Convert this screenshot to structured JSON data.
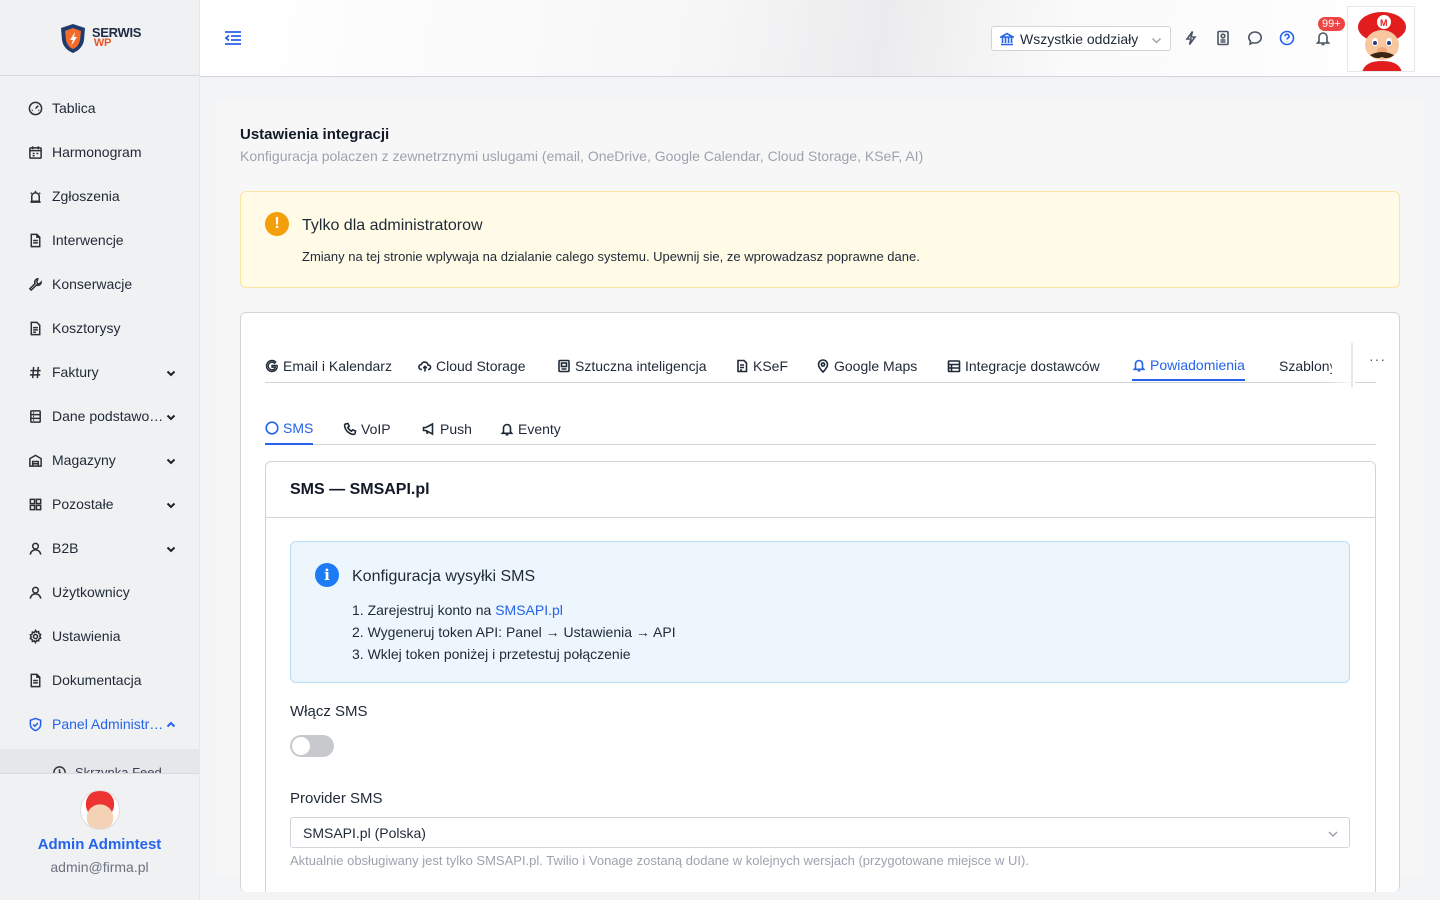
{
  "app": {
    "logo_line1": "SERWIS",
    "logo_line2": "WP"
  },
  "sidebar": {
    "items": [
      {
        "label": "Tablica",
        "icon": "gauge-icon",
        "chevron": ""
      },
      {
        "label": "Harmonogram",
        "icon": "calendar-icon",
        "chevron": ""
      },
      {
        "label": "Zgłoszenia",
        "icon": "alarm-icon",
        "chevron": ""
      },
      {
        "label": "Interwencje",
        "icon": "document-icon",
        "chevron": ""
      },
      {
        "label": "Konserwacje",
        "icon": "wrench-icon",
        "chevron": ""
      },
      {
        "label": "Kosztorysy",
        "icon": "file-list-icon",
        "chevron": ""
      },
      {
        "label": "Faktury",
        "icon": "hash-icon",
        "chevron": "down"
      },
      {
        "label": "Dane podstawowe",
        "icon": "database-icon",
        "chevron": "down"
      },
      {
        "label": "Magazyny",
        "icon": "warehouse-icon",
        "chevron": "down"
      },
      {
        "label": "Pozostałe",
        "icon": "grid-icon",
        "chevron": "down"
      },
      {
        "label": "B2B",
        "icon": "user-icon",
        "chevron": "down"
      },
      {
        "label": "Użytkownicy",
        "icon": "users-icon",
        "chevron": ""
      },
      {
        "label": "Ustawienia",
        "icon": "gear-icon",
        "chevron": ""
      },
      {
        "label": "Dokumentacja",
        "icon": "document-icon",
        "chevron": ""
      },
      {
        "label": "Panel Administratora",
        "icon": "shield-icon",
        "chevron": "up"
      }
    ],
    "sub_item": "Skrzynka Feed",
    "user": {
      "name": "Admin Admintest",
      "email": "admin@firma.pl"
    }
  },
  "header": {
    "branch_select": "Wszystkie oddziały",
    "notifications_badge": "99+"
  },
  "page": {
    "title": "Ustawienia integracji",
    "subtitle": "Konfiguracja polaczen z zewnetrznymi uslugami (email, OneDrive, Google Calendar, Cloud Storage, KSeF, AI)"
  },
  "warning": {
    "icon": "!",
    "title": "Tylko dla administratorow",
    "text": "Zmiany na tej stronie wplywaja na dzialanie calego systemu. Upewnij sie, ze wprowadzasz poprawne dane."
  },
  "tabs": [
    {
      "label": "Email i Kalendarz"
    },
    {
      "label": "Cloud Storage"
    },
    {
      "label": "Sztuczna inteligencja"
    },
    {
      "label": "KSeF"
    },
    {
      "label": "Google Maps"
    },
    {
      "label": "Integracje dostawców"
    },
    {
      "label": "Powiadomienia"
    },
    {
      "label": "Szablony"
    }
  ],
  "tabs_more": "···",
  "subtabs": [
    {
      "label": "SMS"
    },
    {
      "label": "VoIP"
    },
    {
      "label": "Push"
    },
    {
      "label": "Eventy"
    }
  ],
  "sms": {
    "section_title": "SMS — SMSAPI.pl",
    "info_title": "Konfiguracja wysyłki SMS",
    "step1_prefix": "1. Zarejestruj konto na ",
    "step1_link": "SMSAPI.pl",
    "step2": "2. Wygeneruj token API: Panel → Ustawienia → API",
    "step3": "3. Wklej token poniżej i przetestuj połączenie",
    "enable_label": "Włącz SMS",
    "enabled": false,
    "provider_label": "Provider SMS",
    "provider_value": "SMSAPI.pl (Polska)",
    "provider_hint": "Aktualnie obsługiwany jest tylko SMSAPI.pl. Twilio i Vonage zostaną dodane w kolejnych wersjach (przygotowane miejsce w UI)."
  },
  "colors": {
    "accent": "#2563eb",
    "warning": "#f59e0b",
    "info": "#1d7bf5",
    "badge": "#ef4444"
  }
}
